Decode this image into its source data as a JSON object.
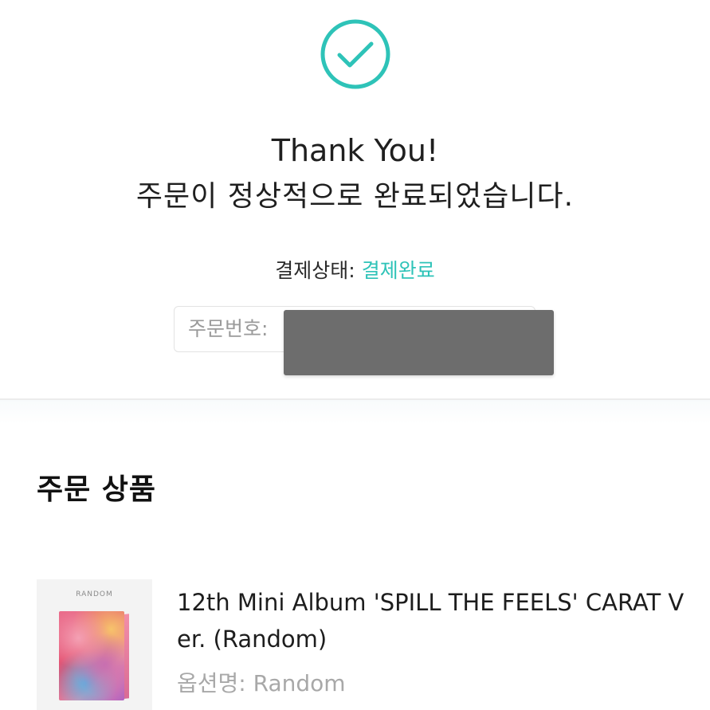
{
  "colors": {
    "accent": "#2ec3b8",
    "text": "#1f1f1f",
    "muted": "#a8a8a8",
    "redaction": "#6d6d6d"
  },
  "icons": {
    "status": "check-circle-icon"
  },
  "confirmation": {
    "title": "Thank You!",
    "message": "주문이 정상적으로 완료되었습니다."
  },
  "payment": {
    "label": "결제상태:",
    "status": "결제완료"
  },
  "order_number": {
    "label": "주문번호:",
    "value_redacted": true
  },
  "order_items": {
    "section_title": "주문 상품",
    "items": [
      {
        "thumbnail_label": "RANDOM",
        "name": "12th Mini Album 'SPILL THE FEELS' CARAT Ver. (Random)",
        "option_label": "옵션명:",
        "option_value": "Random"
      }
    ]
  }
}
